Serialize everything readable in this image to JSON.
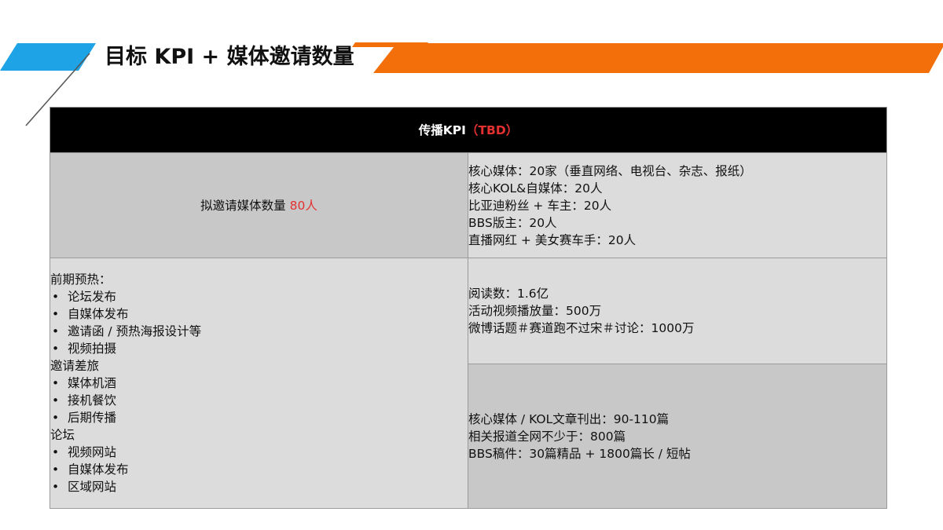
{
  "title": "目标 KPI + 媒体邀请数量",
  "table": {
    "header": {
      "prefix": "传播KPI",
      "suffix": "（TBD）"
    },
    "invite": {
      "label": "拟邀请媒体数量 ",
      "count": "80人"
    },
    "media_breakdown": [
      "核心媒体：20家（垂直网络、电视台、杂志、报纸）",
      "核心KOL&自媒体：20人",
      "比亚迪粉丝 + 车主：20人",
      "BBS版主：20人",
      "直播网红 + 美女赛车手：20人"
    ],
    "plan": {
      "groups": [
        {
          "heading": "前期预热：",
          "items": [
            "论坛发布",
            "自媒体发布",
            "邀请函 / 预热海报设计等",
            "视频拍摄"
          ]
        },
        {
          "heading": "邀请差旅",
          "items": [
            "媒体机酒",
            "接机餐饮",
            "后期传播"
          ]
        },
        {
          "heading": "论坛",
          "items": [
            "视频网站",
            "自媒体发布",
            "区域网站"
          ]
        }
      ]
    },
    "reach_metrics": [
      "阅读数：1.6亿",
      "活动视频播放量：500万",
      "微博话题＃赛道跑不过宋＃讨论：1000万"
    ],
    "output_metrics": [
      "核心媒体 / KOL文章刊出：90-110篇",
      "相关报道全网不少于：800篇",
      "BBS稿件：30篇精品 + 1800篇长 / 短帖"
    ]
  },
  "colors": {
    "accent_blue": "#1ea3e6",
    "accent_orange": "#f26f0a",
    "header_bg": "#000000",
    "highlight_red": "#e53030"
  }
}
